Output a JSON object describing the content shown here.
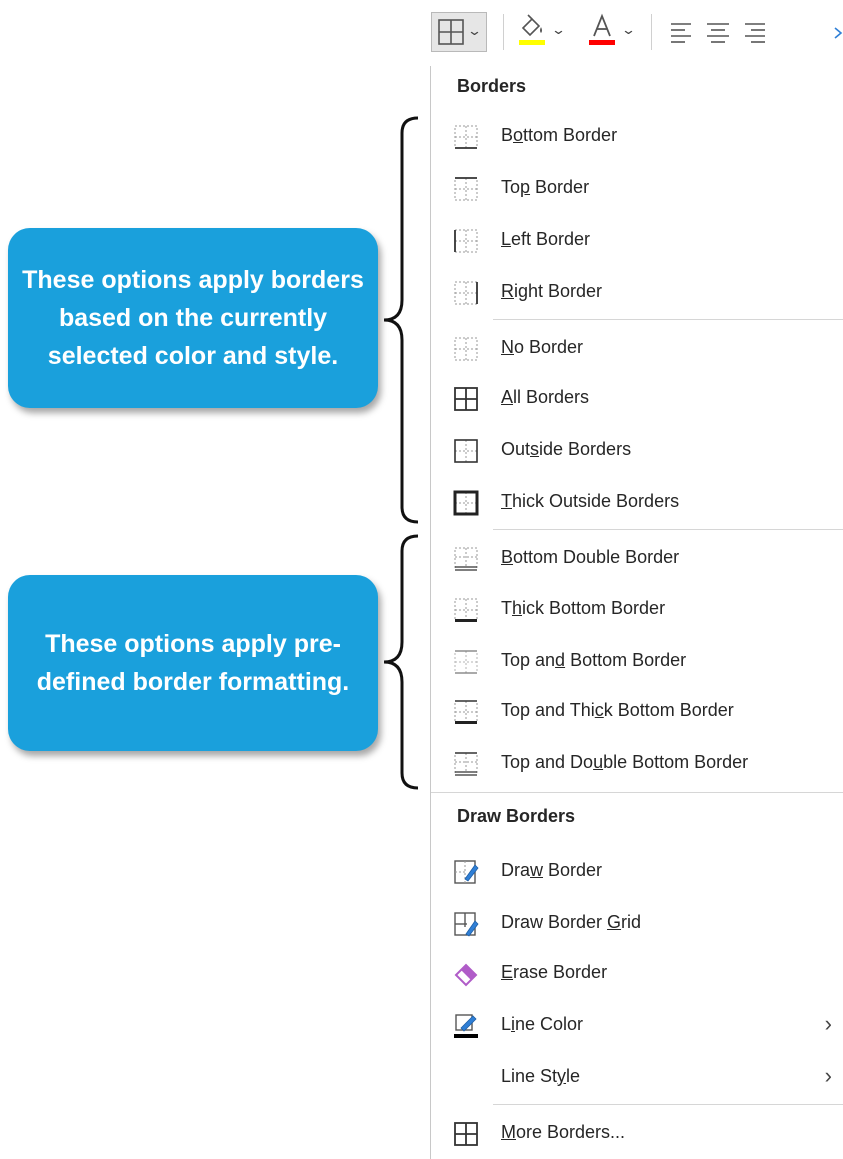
{
  "toolbar": {
    "buttons": [
      {
        "name": "borders-dropdown",
        "icon": "borders-icon"
      },
      {
        "name": "fill-color",
        "icon": "paint-bucket-icon",
        "color": "#ffff00"
      },
      {
        "name": "font-color",
        "icon": "font-color-icon",
        "glyph": "A",
        "color": "#ff0000"
      },
      {
        "name": "align-left",
        "icon": "align-left-icon"
      },
      {
        "name": "align-center",
        "icon": "align-center-icon"
      },
      {
        "name": "align-right",
        "icon": "align-right-icon"
      }
    ]
  },
  "menu": {
    "section1_title": "Borders",
    "items1": [
      {
        "pre": "B",
        "u": "o",
        "post": "ttom Border",
        "icon": "bottom-border-icon"
      },
      {
        "pre": "To",
        "u": "p",
        "post": " Border",
        "icon": "top-border-icon"
      },
      {
        "pre": "",
        "u": "L",
        "post": "eft Border",
        "icon": "left-border-icon"
      },
      {
        "pre": "",
        "u": "R",
        "post": "ight Border",
        "icon": "right-border-icon"
      },
      {
        "pre": "",
        "u": "N",
        "post": "o Border",
        "icon": "no-border-icon"
      },
      {
        "pre": "",
        "u": "A",
        "post": "ll Borders",
        "icon": "all-borders-icon"
      },
      {
        "pre": "Out",
        "u": "s",
        "post": "ide Borders",
        "icon": "outside-borders-icon"
      },
      {
        "pre": "",
        "u": "T",
        "post": "hick Outside Borders",
        "icon": "thick-outside-borders-icon"
      },
      {
        "pre": "",
        "u": "B",
        "post": "ottom Double Border",
        "icon": "bottom-double-border-icon"
      },
      {
        "pre": "T",
        "u": "h",
        "post": "ick Bottom Border",
        "icon": "thick-bottom-border-icon"
      },
      {
        "pre": "Top an",
        "u": "d",
        "post": " Bottom Border",
        "icon": "top-and-bottom-border-icon"
      },
      {
        "pre": "Top and Thi",
        "u": "c",
        "post": "k Bottom Border",
        "icon": "top-and-thick-bottom-border-icon"
      },
      {
        "pre": "Top and Do",
        "u": "u",
        "post": "ble Bottom Border",
        "icon": "top-and-double-bottom-border-icon"
      }
    ],
    "section2_title": "Draw Borders",
    "items2": [
      {
        "pre": "Dra",
        "u": "w",
        "post": " Border",
        "icon": "draw-border-icon"
      },
      {
        "pre": "Draw Border ",
        "u": "G",
        "post": "rid",
        "icon": "draw-border-grid-icon"
      },
      {
        "pre": "",
        "u": "E",
        "post": "rase Border",
        "icon": "eraser-icon"
      },
      {
        "pre": "L",
        "u": "i",
        "post": "ne Color",
        "icon": "line-color-icon",
        "submenu": "›"
      },
      {
        "pre": "Line St",
        "u": "y",
        "post": "le",
        "icon": "",
        "submenu": "›"
      },
      {
        "pre": "",
        "u": "M",
        "post": "ore Borders...",
        "icon": "more-borders-icon"
      }
    ]
  },
  "callouts": [
    {
      "text": "These options apply borders based on the currently selected color and style."
    },
    {
      "text": "These options apply pre-defined border formatting."
    }
  ],
  "colors": {
    "callout": "#1aa0dc",
    "fill_accent": "#ffff00",
    "font_accent": "#ff0000",
    "eraser": "#b05cc8",
    "pen": "#2f7fd6"
  }
}
